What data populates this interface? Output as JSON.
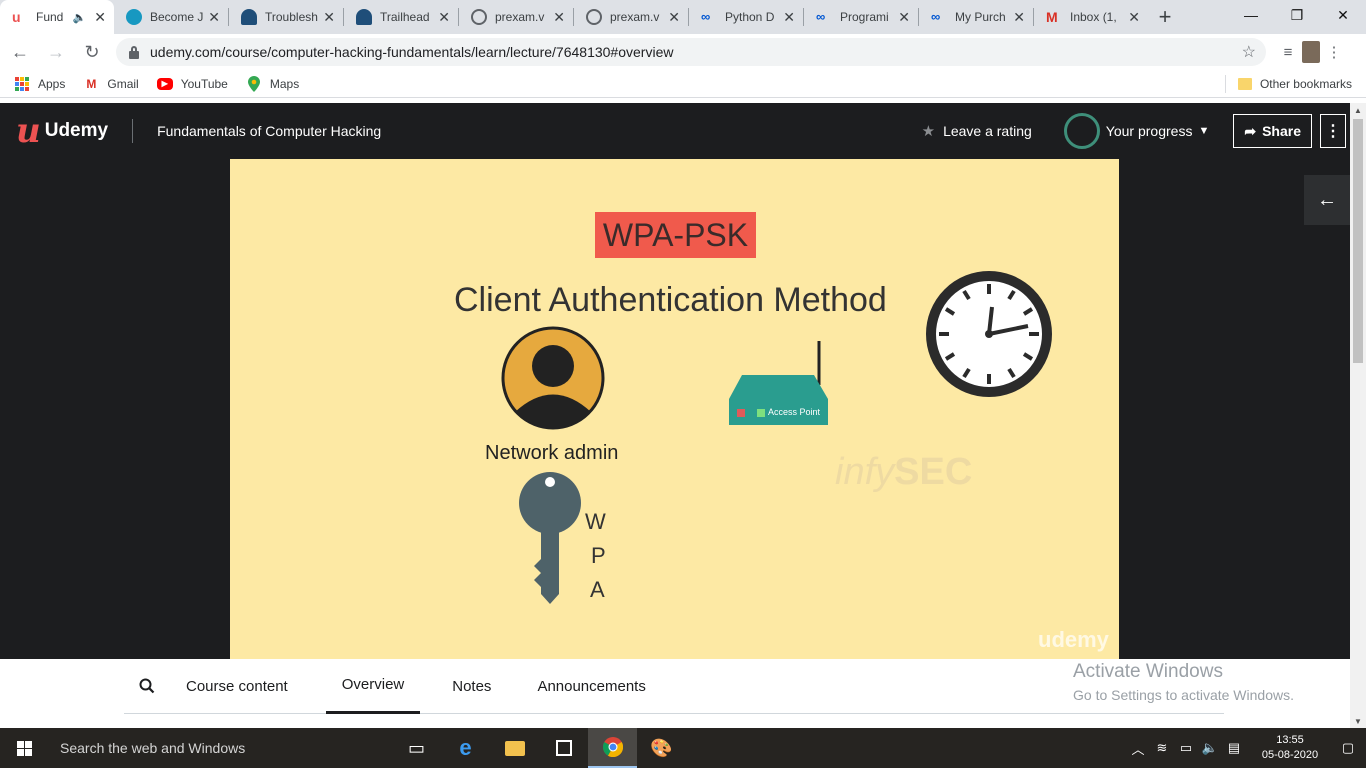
{
  "browser": {
    "tabs": [
      {
        "title": "Fund",
        "favicon": "udemy-icon",
        "color": "#ec5252",
        "active": true
      },
      {
        "title": "Become J",
        "favicon": "salesforce-icon",
        "color": "#1798c1"
      },
      {
        "title": "Troublesh",
        "favicon": "trailhead-icon",
        "color": "#1f4e79"
      },
      {
        "title": "Trailhead",
        "favicon": "trailhead-icon",
        "color": "#1f4e79"
      },
      {
        "title": "prexam.v",
        "favicon": "globe-icon",
        "color": "#5f6368"
      },
      {
        "title": "prexam.v",
        "favicon": "globe-icon",
        "color": "#5f6368"
      },
      {
        "title": "Python D",
        "favicon": "coursera-icon",
        "color": "#0056d2"
      },
      {
        "title": "Programi",
        "favicon": "coursera-icon",
        "color": "#0056d2"
      },
      {
        "title": "My Purch",
        "favicon": "coursera-icon",
        "color": "#0056d2"
      },
      {
        "title": "Inbox (1,",
        "favicon": "gmail-icon",
        "color": "#d93025"
      }
    ],
    "url": "udemy.com/course/computer-hacking-fundamentals/learn/lecture/7648130#overview",
    "bookmarks": [
      {
        "label": "Apps",
        "icon": "apps-grid-icon"
      },
      {
        "label": "Gmail",
        "icon": "gmail-icon"
      },
      {
        "label": "YouTube",
        "icon": "youtube-icon"
      },
      {
        "label": "Maps",
        "icon": "maps-pin-icon"
      }
    ],
    "other_bookmarks": "Other bookmarks"
  },
  "udemy": {
    "brand": "Udemy",
    "course_title": "Fundamentals of Computer Hacking",
    "leave_rating": "Leave a rating",
    "your_progress": "Your progress",
    "share": "Share",
    "accent": "#ec5252"
  },
  "slide": {
    "badge": "WPA-PSK",
    "heading": "Client Authentication Method",
    "admin_label": "Network admin",
    "access_point_label": "Access Point",
    "key_letters": [
      "W",
      "P",
      "A"
    ],
    "watermark_prefix": "infy",
    "watermark_suffix": "SEC",
    "udemy_watermark": "udemy"
  },
  "course_tabs": {
    "items": [
      "Course content",
      "Overview",
      "Notes",
      "Announcements"
    ],
    "active": "Overview"
  },
  "activate_windows": {
    "title": "Activate Windows",
    "subtitle": "Go to Settings to activate Windows."
  },
  "taskbar": {
    "search_placeholder": "Search the web and Windows",
    "time": "13:55",
    "date": "05-08-2020"
  }
}
